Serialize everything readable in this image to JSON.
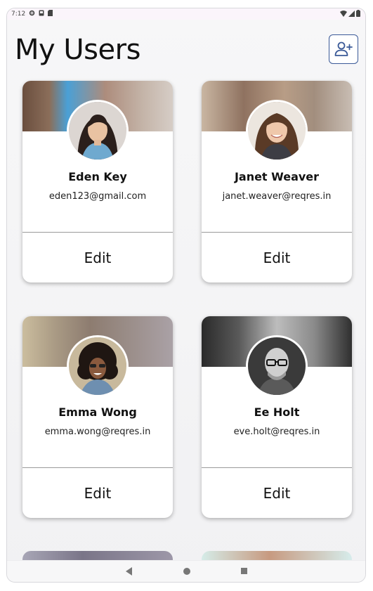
{
  "status_bar": {
    "time": "7:12"
  },
  "header": {
    "title": "My Users"
  },
  "users": [
    {
      "name": "Eden Key",
      "email": "eden123@gmail.com",
      "edit_label": "Edit"
    },
    {
      "name": "Janet Weaver",
      "email": "janet.weaver@reqres.in",
      "edit_label": "Edit"
    },
    {
      "name": "Emma Wong",
      "email": "emma.wong@reqres.in",
      "edit_label": "Edit"
    },
    {
      "name": "Ee Holt",
      "email": "eve.holt@reqres.in",
      "edit_label": "Edit"
    }
  ],
  "icons": {
    "add_user": "person-add-icon",
    "nav_back": "back-triangle-icon",
    "nav_home": "home-circle-icon",
    "nav_recent": "recent-square-icon"
  },
  "colors": {
    "accent": "#3b5a98",
    "card_background": "#ffffff",
    "screen_background": "#f4f4f6"
  }
}
